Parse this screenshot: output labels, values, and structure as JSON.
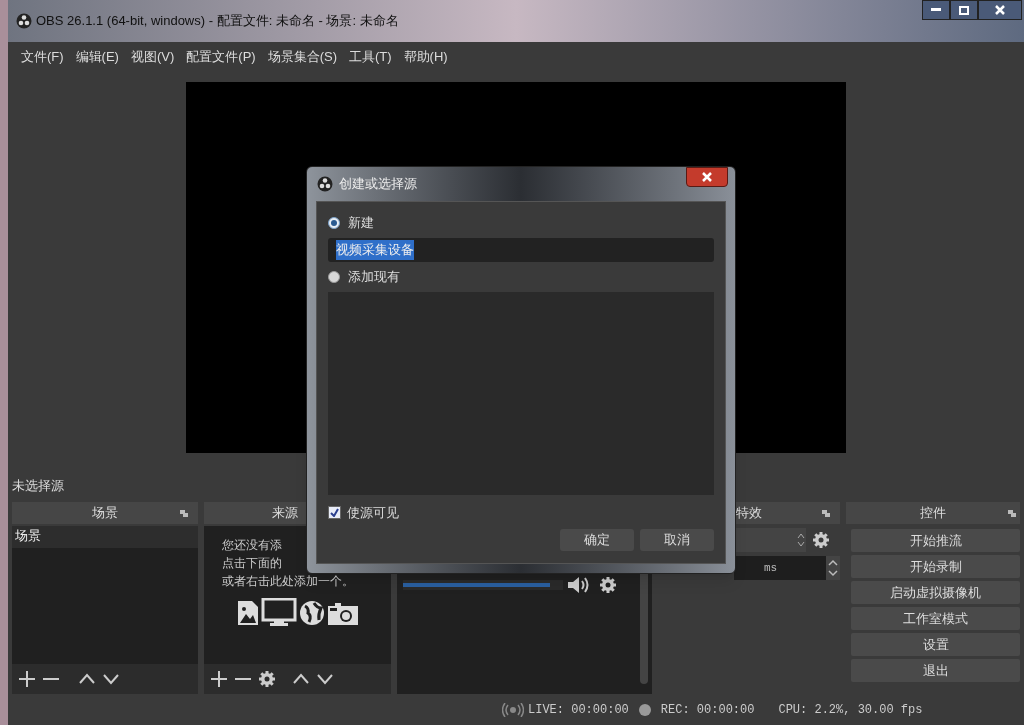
{
  "window": {
    "title": "OBS 26.1.1 (64-bit, windows) - 配置文件: 未命名 - 场景: 未命名"
  },
  "menu": [
    "文件(F)",
    "编辑(E)",
    "视图(V)",
    "配置文件(P)",
    "场景集合(S)",
    "工具(T)",
    "帮助(H)"
  ],
  "source_label": "未选择源",
  "scenes": {
    "title": "场景",
    "items": [
      {
        "label": "场景",
        "selected": true
      }
    ]
  },
  "sources": {
    "title": "来源",
    "empty_lines": [
      "您还没有添",
      "点击下面的",
      "或者右击此处添加一个。"
    ]
  },
  "mixer": {
    "level": 0.92
  },
  "transitions": {
    "title": "特效",
    "duration": "ms"
  },
  "controls": {
    "title": "控件",
    "buttons": [
      "开始推流",
      "开始录制",
      "启动虚拟摄像机",
      "工作室模式",
      "设置",
      "退出"
    ]
  },
  "status": {
    "live": "LIVE: 00:00:00",
    "rec": "REC: 00:00:00",
    "cpu": "CPU: 2.2%, 30.00 fps"
  },
  "dialog": {
    "title": "创建或选择源",
    "options": [
      {
        "label": "新建",
        "selected": true
      },
      {
        "label": "添加现有",
        "selected": false
      }
    ],
    "name_value": "视频采集设备",
    "visible_checkbox": {
      "label": "使源可见",
      "checked": true
    },
    "buttons": [
      "确定",
      "取消"
    ]
  }
}
